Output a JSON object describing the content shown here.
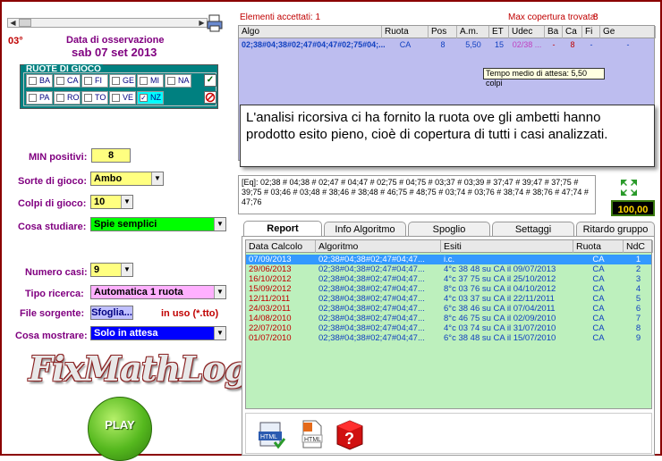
{
  "left": {
    "degree": "03°",
    "date_label": "Data di osservazione",
    "date_value": "sab 07 set 2013",
    "ruote_title": "RUOTE DI GIOCO",
    "ruote": [
      {
        "name": "BA",
        "checked": false
      },
      {
        "name": "CA",
        "checked": false
      },
      {
        "name": "FI",
        "checked": false
      },
      {
        "name": "GE",
        "checked": false
      },
      {
        "name": "MI",
        "checked": false
      },
      {
        "name": "NA",
        "checked": false
      },
      {
        "name": "PA",
        "checked": false
      },
      {
        "name": "RO",
        "checked": false
      },
      {
        "name": "TO",
        "checked": false
      },
      {
        "name": "VE",
        "checked": false
      },
      {
        "name": "NZ",
        "checked": true
      }
    ],
    "min_positivi_label": "MIN positivi:",
    "min_positivi_value": "8",
    "sorte_label": "Sorte di gioco:",
    "sorte_value": "Ambo",
    "colpi_label": "Colpi di gioco:",
    "colpi_value": "10",
    "cosa_studiare_label": "Cosa studiare:",
    "cosa_studiare_value": "Spie semplici",
    "numero_casi_label": "Numero casi:",
    "numero_casi_value": "9",
    "tipo_ricerca_label": "Tipo ricerca:",
    "tipo_ricerca_value": "Automatica 1 ruota",
    "file_sorgente_label": "File sorgente:",
    "file_sorgente_button": "Sfoglia...",
    "in_uso": "in uso (*.tto)",
    "cosa_mostrare_label": "Cosa mostrare:",
    "cosa_mostrare_value": "Solo in attesa",
    "logo": "FixMathLog",
    "play": "PLAY"
  },
  "top": {
    "elementi": "Elementi accettati: 1",
    "max_cop_label": "Max copertura trovata:",
    "max_cop_value": "8",
    "headers": [
      "Algo",
      "Ruota",
      "Pos",
      "A.m.",
      "ET",
      "Udec",
      "Ba",
      "Ca",
      "Fi",
      "Ge"
    ],
    "row": [
      "02;38#04;38#02;47#04;47#02;75#04;...",
      "CA",
      "8",
      "5,50",
      "15",
      "02/38 ...",
      "-",
      "8",
      "-",
      "-"
    ],
    "tooltip": "Tempo medio di attesa: 5,50 colpi",
    "note": "L'analisi ricorsiva ci ha fornito la ruota ove gli ambetti hanno prodotto esito pieno, cioè di copertura di tutti i casi analizzati.",
    "eq": "[Eq]: 02;38 # 04;38 # 02;47 # 04;47 # 02;75 # 04;75 # 03;37 # 03;39 # 37;47 # 39;47 # 37;75 # 39;75 # 03;46 # 03;48 # 38;46 # 38;48 # 46;75 # 48;75 # 03;74 # 03;76 # 38;74 # 38;76 # 47;74 # 47;76",
    "percent": "100,00 %"
  },
  "tabs": [
    "Report",
    "Info Algoritmo",
    "Spoglio",
    "Settaggi",
    "Ritardo gruppo"
  ],
  "report": {
    "headers": [
      "Data Calcolo",
      "Algoritmo",
      "Esiti",
      "Ruota",
      "NdC"
    ],
    "rows": [
      [
        "07/09/2013",
        "02;38#04;38#02;47#04;47...",
        "i.c.",
        "CA",
        "1"
      ],
      [
        "29/06/2013",
        "02;38#04;38#02;47#04;47...",
        "4°c 38 48 su CA il 09/07/2013",
        "CA",
        "2"
      ],
      [
        "16/10/2012",
        "02;38#04;38#02;47#04;47...",
        "4°c 37 75 su CA il 25/10/2012",
        "CA",
        "3"
      ],
      [
        "15/09/2012",
        "02;38#04;38#02;47#04;47...",
        "8°c 03 76 su CA il 04/10/2012",
        "CA",
        "4"
      ],
      [
        "12/11/2011",
        "02;38#04;38#02;47#04;47...",
        "4°c 03 37 su CA il 22/11/2011",
        "CA",
        "5"
      ],
      [
        "24/03/2011",
        "02;38#04;38#02;47#04;47...",
        "6°c 38 46 su CA il 07/04/2011",
        "CA",
        "6"
      ],
      [
        "14/08/2010",
        "02;38#04;38#02;47#04;47...",
        "8°c 46 75 su CA il 02/09/2010",
        "CA",
        "7"
      ],
      [
        "22/07/2010",
        "02;38#04;38#02;47#04;47...",
        "4°c 03 74 su CA il 31/07/2010",
        "CA",
        "8"
      ],
      [
        "01/07/2010",
        "02;38#04;38#02;47#04;47...",
        "6°c 38 48 su CA il 15/07/2010",
        "CA",
        "9"
      ]
    ]
  },
  "colors": {
    "accent": "#800080",
    "red": "#c00000",
    "grid_blue": "#bdbdef",
    "grid_green": "#bdf0bd",
    "selected": "#3399ff",
    "frame": "#8b0000"
  }
}
